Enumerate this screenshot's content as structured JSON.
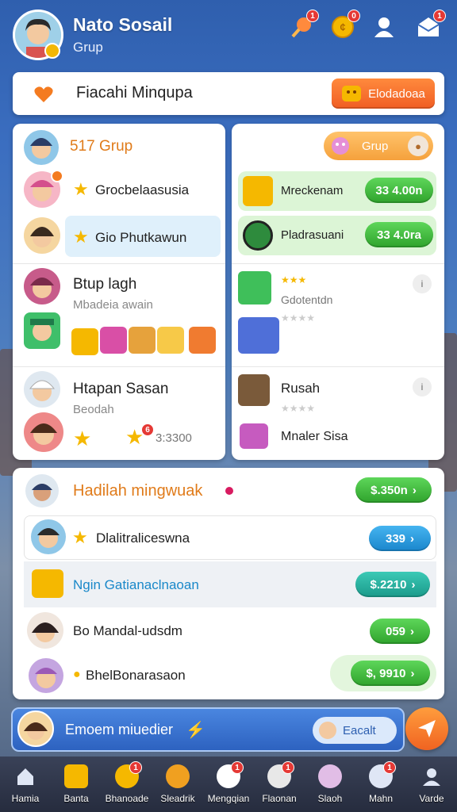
{
  "header": {
    "title": "Nato Sosail",
    "subtitle": "Grup",
    "icons": [
      {
        "name": "lollipop-icon",
        "badge": "1"
      },
      {
        "name": "coin-icon",
        "badge": "0"
      },
      {
        "name": "user-icon",
        "badge": ""
      },
      {
        "name": "mail-icon",
        "badge": "1"
      }
    ]
  },
  "search": {
    "title": "Fiacahi Minqupa",
    "button_label": "Elodadoaa"
  },
  "left_panel": {
    "group_title": "517 Grup",
    "members": [
      {
        "name": "Grocbelaasusia"
      },
      {
        "name": "Gio Phutkawun"
      }
    ],
    "card1": {
      "title": "Btup lagh",
      "subtitle": "Mbadeia awain"
    },
    "card2": {
      "title": "Htapan Sasan",
      "subtitle": "Beodah",
      "amount": "3:3300",
      "badge": "6"
    }
  },
  "right_panel": {
    "button_label": "Grup",
    "items": [
      {
        "name": "Mreckenam",
        "price": "33 4.00n"
      },
      {
        "name": "Pladrasuani",
        "price": "33 4.0ra"
      }
    ],
    "card1": {
      "subtitle": "Gdotentdn"
    },
    "card2": {
      "title": "Rusah",
      "sub_item": "Mnaler Sisa"
    }
  },
  "rewards": {
    "title": "Hadilah mingwuak",
    "title_price": "$.350n",
    "rows": [
      {
        "label": "Dlalitraliceswna",
        "price": "339"
      },
      {
        "label": "Ngin Gatianaclnaoan",
        "price": "$.2210"
      },
      {
        "label": "Bo Mandal-udsdm",
        "price": "059"
      },
      {
        "label": "BhelBonarasaon",
        "price": "$, 9910"
      }
    ]
  },
  "chat": {
    "text": "Emoem miuedier",
    "button_label": "Eacalt"
  },
  "nav": [
    {
      "label": "Hamia",
      "badge": ""
    },
    {
      "label": "Banta",
      "badge": ""
    },
    {
      "label": "Bhanoade",
      "badge": "1"
    },
    {
      "label": "Sleadrik",
      "badge": ""
    },
    {
      "label": "Mengqian",
      "badge": "1"
    },
    {
      "label": "Flaonan",
      "badge": "1"
    },
    {
      "label": "Slaoh",
      "badge": ""
    },
    {
      "label": "Mahn",
      "badge": "1"
    },
    {
      "label": "Varde",
      "badge": ""
    }
  ]
}
